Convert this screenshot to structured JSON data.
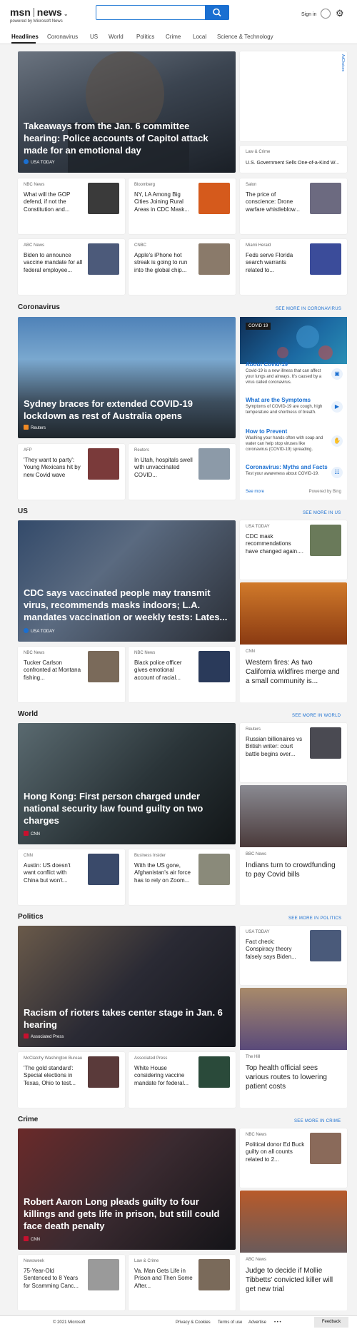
{
  "header": {
    "logo": "msn",
    "product": "news",
    "powered_by": "powered by Microsoft News",
    "search_placeholder": "",
    "sign_in": "Sign in",
    "search_icon": "search-icon",
    "settings_icon": "gear-icon"
  },
  "nav": [
    "Headlines",
    "Coronavirus",
    "US",
    "World",
    "Politics",
    "Crime",
    "Local",
    "Science & Technology"
  ],
  "headlines": {
    "hero": {
      "title": "Takeaways from the Jan. 6 committee hearing: Police accounts of Capitol attack made for an emotional day",
      "source": "USA TODAY"
    },
    "ad_label": "AdChoices",
    "side": {
      "source": "Law & Crime",
      "title": "U.S. Government Sells One-of-a-Kind W..."
    },
    "cards": [
      {
        "source": "NBC News",
        "title": "What will the GOP defend, if not the Constitution and..."
      },
      {
        "source": "Bloomberg",
        "title": "NY, LA Among Big Cities Joining Rural Areas in CDC Mask..."
      },
      {
        "source": "Salon",
        "title": "The price of conscience: Drone warfare whistleblow..."
      },
      {
        "source": "ABC News",
        "title": "Biden to announce vaccine mandate for all federal employee..."
      },
      {
        "source": "CNBC",
        "title": "Apple's iPhone hot streak is going to run into the global chip..."
      },
      {
        "source": "Miami Herald",
        "title": "Feds serve Florida search warrants related to..."
      }
    ]
  },
  "coronavirus": {
    "section": "Coronavirus",
    "more": "SEE MORE IN CORONAVIRUS",
    "hero": {
      "title": "Sydney braces for extended COVID-19 lockdown as rest of Australia opens",
      "source": "Reuters"
    },
    "cards": [
      {
        "source": "AFP",
        "title": "'They want to party': Young Mexicans hit by new Covid wave"
      },
      {
        "source": "Reuters",
        "title": "In Utah, hospitals swell with unvaccinated COVID..."
      }
    ],
    "panel": {
      "badge": "COVID 19",
      "items": [
        {
          "title": "About Covid-19",
          "desc": "Covid-19 is a new illness that can affect your lungs and airways. It's caused by a virus called coronavirus."
        },
        {
          "title": "What are the Symptoms",
          "desc": "Symptoms of COVID-19 are cough, high temperature and shortness of breath."
        },
        {
          "title": "How to Prevent",
          "desc": "Washing your hands often with soap and water can help stop viruses like coronavirus (COVID-19) spreading."
        },
        {
          "title": "Coronavirus: Myths and Facts",
          "desc": "Test your awareness about COVID-19."
        }
      ],
      "see_more": "See more",
      "powered": "Powered by Bing"
    }
  },
  "us": {
    "section": "US",
    "more": "SEE MORE IN US",
    "hero": {
      "title": "CDC says vaccinated people may transmit virus, recommends masks indoors; L.A. mandates vaccination or weekly tests: Lates...",
      "source": "USA TODAY"
    },
    "side": {
      "source": "USA TODAY",
      "title": "CDC mask recommendations have changed again...."
    },
    "imgcard": {
      "source": "CNN",
      "title": "Western fires: As two California wildfires merge and a small community is..."
    },
    "cards": [
      {
        "source": "NBC News",
        "title": "Tucker Carlson confronted at Montana fishing..."
      },
      {
        "source": "NBC News",
        "title": "Black police officer gives emotional account of racial..."
      }
    ]
  },
  "world": {
    "section": "World",
    "more": "SEE MORE IN WORLD",
    "hero": {
      "title": "Hong Kong: First person charged under national security law found guilty on two charges",
      "source": "CNN"
    },
    "side": {
      "source": "Reuters",
      "title": "Russian billionaires vs British writer: court battle begins over..."
    },
    "imgcard": {
      "source": "BBC News",
      "title": "Indians turn to crowdfunding to pay Covid bills"
    },
    "cards": [
      {
        "source": "CNN",
        "title": "Austin: US doesn't want conflict with China but won't..."
      },
      {
        "source": "Business Insider",
        "title": "With the US gone, Afghanistan's air force has to rely on Zoom..."
      }
    ]
  },
  "politics": {
    "section": "Politics",
    "more": "SEE MORE IN POLITICS",
    "hero": {
      "title": "Racism of rioters takes center stage in Jan. 6 hearing",
      "source": "Associated Press"
    },
    "side": {
      "source": "USA TODAY",
      "title": "Fact check: Conspiracy theory falsely says Biden..."
    },
    "imgcard": {
      "source": "The Hill",
      "title": "Top health official sees various routes to lowering patient costs"
    },
    "cards": [
      {
        "source": "McClatchy Washington Bureau",
        "title": "'The gold standard': Special elections in Texas, Ohio to test..."
      },
      {
        "source": "Associated Press",
        "title": "White House considering vaccine mandate for federal..."
      }
    ]
  },
  "crime": {
    "section": "Crime",
    "more": "SEE MORE IN CRIME",
    "hero": {
      "title": "Robert Aaron Long pleads guilty to four killings and gets life in prison, but still could face death penalty",
      "source": "CNN"
    },
    "side": {
      "source": "NBC News",
      "title": "Political donor Ed Buck guilty on all counts related to 2..."
    },
    "imgcard": {
      "source": "ABC News",
      "title": "Judge to decide if Mollie Tibbetts' convicted killer will get new trial"
    },
    "cards": [
      {
        "source": "Newsweek",
        "title": "75-Year-Old Sentenced to 8 Years for Scamming Canc..."
      },
      {
        "source": "Law & Crime",
        "title": "Va. Man Gets Life in Prison and Then Some After..."
      }
    ]
  },
  "footer": {
    "copyright": "© 2021 Microsoft",
    "links": [
      "Privacy & Cookies",
      "Terms of use",
      "Advertise"
    ],
    "more": "• • •",
    "feedback": "Feedback"
  }
}
